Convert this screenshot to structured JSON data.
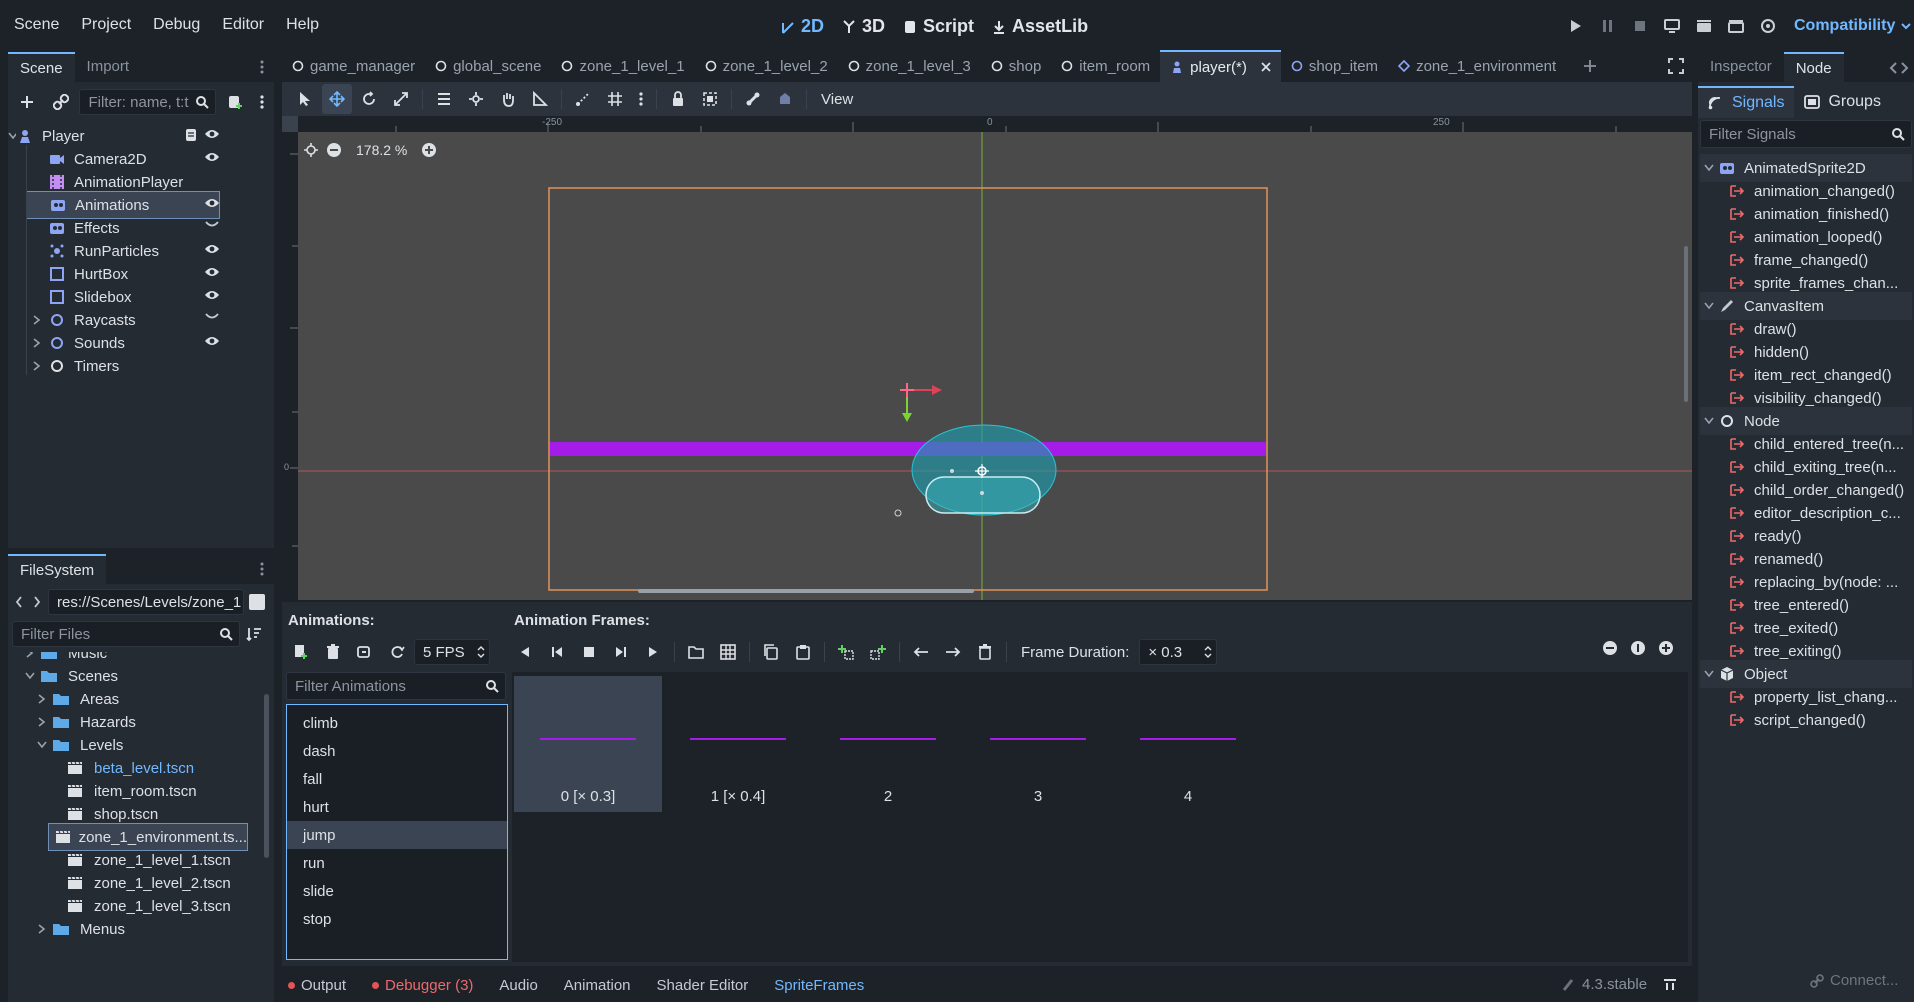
{
  "menu": [
    "Scene",
    "Project",
    "Debug",
    "Editor",
    "Help"
  ],
  "workspaces": [
    {
      "label": "2D",
      "icon": "2d-icon",
      "active": true
    },
    {
      "label": "3D",
      "icon": "3d-icon",
      "active": false
    },
    {
      "label": "Script",
      "icon": "script-icon",
      "active": false
    },
    {
      "label": "AssetLib",
      "icon": "assetlib-icon",
      "active": false
    }
  ],
  "renderer": "Compatibility",
  "scene_dock": {
    "tabs": [
      "Scene",
      "Import"
    ],
    "filter_placeholder": "Filter: name, t:t",
    "nodes": [
      {
        "label": "Player",
        "icon": "character-icon",
        "color": "#8da5f3",
        "depth": 0,
        "selected": false
      },
      {
        "label": "Camera2D",
        "icon": "camera-icon",
        "color": "#8da5f3",
        "depth": 1,
        "selected": false
      },
      {
        "label": "AnimationPlayer",
        "icon": "animation-player-icon",
        "color": "#c38ef1",
        "depth": 1,
        "selected": false
      },
      {
        "label": "Animations",
        "icon": "animated-sprite-icon",
        "color": "#8da5f3",
        "depth": 1,
        "selected": true
      },
      {
        "label": "Effects",
        "icon": "animated-sprite-icon",
        "color": "#8da5f3",
        "depth": 1,
        "selected": false
      },
      {
        "label": "RunParticles",
        "icon": "particles-icon",
        "color": "#8da5f3",
        "depth": 1,
        "selected": false
      },
      {
        "label": "HurtBox",
        "icon": "area-icon",
        "color": "#8da5f3",
        "depth": 1,
        "selected": false
      },
      {
        "label": "Slidebox",
        "icon": "area-icon",
        "color": "#8da5f3",
        "depth": 1,
        "selected": false
      },
      {
        "label": "Raycasts",
        "icon": "node2d-icon",
        "color": "#8da5f3",
        "depth": 1,
        "selected": false
      },
      {
        "label": "Sounds",
        "icon": "node2d-icon",
        "color": "#8da5f3",
        "depth": 1,
        "selected": false
      },
      {
        "label": "Timers",
        "icon": "node-icon",
        "color": "#e0e0e0",
        "depth": 1,
        "selected": false
      }
    ]
  },
  "filesystem": {
    "title": "FileSystem",
    "path": "res://Scenes/Levels/zone_1",
    "filter_placeholder": "Filter Files",
    "items": [
      {
        "label": "Music",
        "type": "folder",
        "depth": 0
      },
      {
        "label": "Scenes",
        "type": "folder",
        "depth": 0
      },
      {
        "label": "Areas",
        "type": "folder",
        "depth": 1
      },
      {
        "label": "Hazards",
        "type": "folder",
        "depth": 1
      },
      {
        "label": "Levels",
        "type": "folder",
        "depth": 1
      },
      {
        "label": "beta_level.tscn",
        "type": "scene",
        "depth": 2
      },
      {
        "label": "item_room.tscn",
        "type": "scene",
        "depth": 2
      },
      {
        "label": "shop.tscn",
        "type": "scene",
        "depth": 2
      },
      {
        "label": "zone_1_environment.ts...",
        "type": "scene",
        "depth": 2
      },
      {
        "label": "zone_1_level_1.tscn",
        "type": "scene",
        "depth": 2
      },
      {
        "label": "zone_1_level_2.tscn",
        "type": "scene",
        "depth": 2
      },
      {
        "label": "zone_1_level_3.tscn",
        "type": "scene",
        "depth": 2
      },
      {
        "label": "Menus",
        "type": "folder",
        "depth": 1
      }
    ]
  },
  "scene_tabs": [
    {
      "label": "game_manager",
      "active": false
    },
    {
      "label": "global_scene",
      "active": false
    },
    {
      "label": "zone_1_level_1",
      "active": false
    },
    {
      "label": "zone_1_level_2",
      "active": false
    },
    {
      "label": "zone_1_level_3",
      "active": false
    },
    {
      "label": "shop",
      "active": false
    },
    {
      "label": "item_room",
      "active": false
    },
    {
      "label": "player(*)",
      "active": true
    },
    {
      "label": "shop_item",
      "active": false
    },
    {
      "label": "zone_1_environment",
      "active": false
    }
  ],
  "toolbar": {
    "view_label": "View"
  },
  "viewport": {
    "zoom": "178.2 %",
    "ruler_labels": [
      "-250",
      "0",
      "250"
    ],
    "ruler_side_label": "0"
  },
  "bottom_panel": {
    "animations_title": "Animations:",
    "frames_title": "Animation Frames:",
    "fps_value": "5 FPS",
    "frame_duration_label": "Frame Duration:",
    "frame_duration_value": "× 0.3",
    "filter_placeholder": "Filter Animations",
    "animations": [
      {
        "label": "climb",
        "selected": false
      },
      {
        "label": "dash",
        "selected": false
      },
      {
        "label": "fall",
        "selected": false
      },
      {
        "label": "hurt",
        "selected": false
      },
      {
        "label": "jump",
        "selected": true
      },
      {
        "label": "run",
        "selected": false
      },
      {
        "label": "slide",
        "selected": false
      },
      {
        "label": "stop",
        "selected": false
      }
    ],
    "frames": [
      {
        "label": "0 [× 0.3]",
        "selected": true
      },
      {
        "label": "1 [× 0.4]",
        "selected": false
      },
      {
        "label": "2",
        "selected": false
      },
      {
        "label": "3",
        "selected": false
      },
      {
        "label": "4",
        "selected": false
      }
    ]
  },
  "bottom_tabs": [
    {
      "label": "Output",
      "dot": "#e05555"
    },
    {
      "label": "Debugger (3)",
      "dot": "#e05555",
      "color": "#ee6a6a"
    },
    {
      "label": "Audio"
    },
    {
      "label": "Animation"
    },
    {
      "label": "Shader Editor"
    },
    {
      "label": "SpriteFrames",
      "color": "#72b8ff"
    }
  ],
  "version": "4.3.stable",
  "inspector": {
    "tabs": [
      "Inspector",
      "Node"
    ],
    "subtabs": [
      "Signals",
      "Groups"
    ],
    "filter_placeholder": "Filter Signals",
    "connect_label": "Connect...",
    "signals": [
      {
        "label": "AnimatedSprite2D",
        "category": true,
        "icon": "animated-sprite-icon"
      },
      {
        "label": "animation_changed()",
        "category": false
      },
      {
        "label": "animation_finished()",
        "category": false
      },
      {
        "label": "animation_looped()",
        "category": false
      },
      {
        "label": "frame_changed()",
        "category": false
      },
      {
        "label": "sprite_frames_chan...",
        "category": false
      },
      {
        "label": "CanvasItem",
        "category": true,
        "icon": "pencil-icon"
      },
      {
        "label": "draw()",
        "category": false
      },
      {
        "label": "hidden()",
        "category": false
      },
      {
        "label": "item_rect_changed()",
        "category": false
      },
      {
        "label": "visibility_changed()",
        "category": false
      },
      {
        "label": "Node",
        "category": true,
        "icon": "node-icon"
      },
      {
        "label": "child_entered_tree(n...",
        "category": false
      },
      {
        "label": "child_exiting_tree(n...",
        "category": false
      },
      {
        "label": "child_order_changed()",
        "category": false
      },
      {
        "label": "editor_description_c...",
        "category": false
      },
      {
        "label": "ready()",
        "category": false
      },
      {
        "label": "renamed()",
        "category": false
      },
      {
        "label": "replacing_by(node: ...",
        "category": false
      },
      {
        "label": "tree_entered()",
        "category": false
      },
      {
        "label": "tree_exited()",
        "category": false
      },
      {
        "label": "tree_exiting()",
        "category": false
      },
      {
        "label": "Object",
        "category": true,
        "icon": "object-icon"
      },
      {
        "label": "property_list_chang...",
        "category": false
      },
      {
        "label": "script_changed()",
        "category": false
      }
    ]
  }
}
